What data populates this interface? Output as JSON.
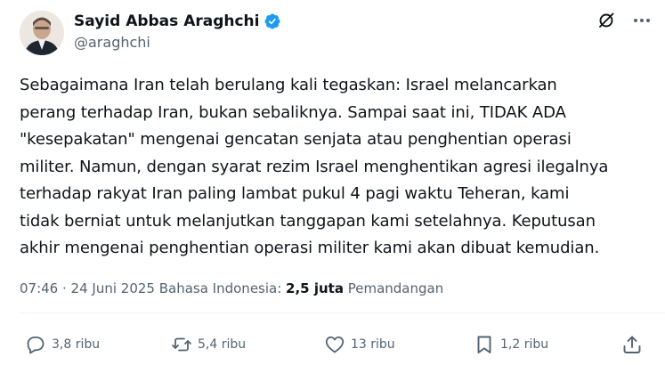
{
  "author": {
    "display_name": "Sayid Abbas Araghchi",
    "handle": "@araghchi",
    "verified": true
  },
  "tweet": {
    "text": "Sebagaimana Iran telah berulang kali tegaskan: Israel melancarkan\nperang terhadap Iran, bukan sebaliknya. Sampai saat ini, TIDAK ADA\n\"kesepakatan\" mengenai gencatan senjata atau penghentian operasi\nmiliter. Namun, dengan syarat rezim Israel menghentikan agresi ilegalnya\nterhadap rakyat Iran paling lambat pukul 4 pagi waktu Teheran, kami\ntidak berniat untuk melanjutkan tanggapan kami setelahnya. Keputusan\nakhir mengenai penghentian operasi militer kami akan dibuat kemudian."
  },
  "meta": {
    "time": "07:46",
    "separator": " · ",
    "date": "24 Juni 2025",
    "language": " Bahasa Indonesia: ",
    "views_count": "2,5 juta",
    "views_label": " Pemandangan"
  },
  "actions": {
    "replies": {
      "icon": "reply-icon",
      "count": "3,8 ribu"
    },
    "reposts": {
      "icon": "repost-icon",
      "count": "5,4 ribu"
    },
    "likes": {
      "icon": "heart-icon",
      "count": "13 ribu"
    },
    "bookmarks": {
      "icon": "bookmark-icon",
      "count": "1,2 ribu"
    },
    "share": {
      "icon": "share-icon"
    }
  },
  "colors": {
    "text_primary": "#0f1419",
    "text_secondary": "#536471",
    "verified_blue": "#1d9bf0",
    "divider": "#eff3f4"
  }
}
